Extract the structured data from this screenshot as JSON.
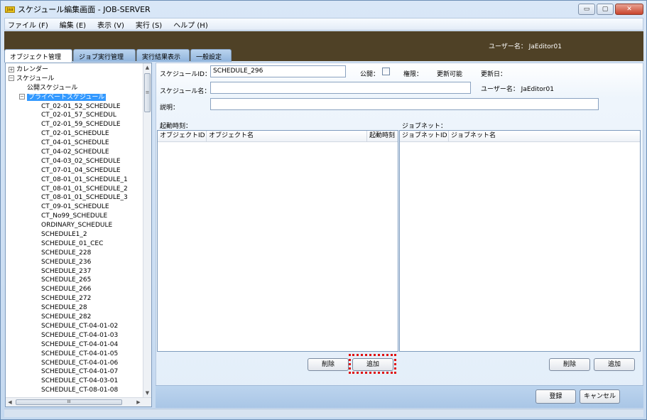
{
  "window": {
    "app_icon_text": "Jaa",
    "title": "スケジュール編集画面 - JOB-SERVER",
    "buttons": {
      "minimize": "▭",
      "maximize": "▢",
      "close": "✕"
    }
  },
  "menu": [
    "ファイル (F)",
    "編集 (E)",
    "表示 (V)",
    "実行 (S)",
    "ヘルプ (H)"
  ],
  "header": {
    "user": "ユーザー名： JaEditor01"
  },
  "tabs": [
    "オブジェクト管理",
    "ジョブ実行管理",
    "実行結果表示",
    "一般設定"
  ],
  "tree": {
    "calendar": "カレンダー",
    "schedule": "スケジュール",
    "public_schedule": "公開スケジュール",
    "private_schedule": "プライベートスケジュール",
    "expand_plus": "+",
    "expand_minus": "−",
    "items": [
      "CT_02-01_52_SCHEDULE",
      "CT_02-01_57_SCHEDUL",
      "CT_02-01_59_SCHEDULE",
      "CT_02-01_SCHEDULE",
      "CT_04-01_SCHEDULE",
      "CT_04-02_SCHEDULE",
      "CT_04-03_02_SCHEDULE",
      "CT_07-01_04_SCHEDULE",
      "CT_08-01_01_SCHEDULE_1",
      "CT_08-01_01_SCHEDULE_2",
      "CT_08-01_01_SCHEDULE_3",
      "CT_09-01_SCHEDULE",
      "CT_No99_SCHEDULE",
      "ORDINARY_SCHEDULE",
      "SCHEDULE1_2",
      "SCHEDULE_01_CEC",
      "SCHEDULE_228",
      "SCHEDULE_236",
      "SCHEDULE_237",
      "SCHEDULE_265",
      "SCHEDULE_266",
      "SCHEDULE_272",
      "SCHEDULE_28",
      "SCHEDULE_282",
      "SCHEDULE_CT-04-01-02",
      "SCHEDULE_CT-04-01-03",
      "SCHEDULE_CT-04-01-04",
      "SCHEDULE_CT-04-01-05",
      "SCHEDULE_CT-04-01-06",
      "SCHEDULE_CT-04-01-07",
      "SCHEDULE_CT-04-03-01",
      "SCHEDULE_CT-08-01-08"
    ],
    "scroll": {
      "up": "▲",
      "down": "▼",
      "left": "◀",
      "right": "▶",
      "grip": "≡",
      "hgrip": "III"
    }
  },
  "form": {
    "schedule_id_label": "スケジュールID：",
    "schedule_id_value": "SCHEDULE_296",
    "public_label": "公開：",
    "permission_label": "権限：",
    "permission_value": "更新可能",
    "updated_date_label": "更新日：",
    "schedule_name_label": "スケジュール名：",
    "schedule_name_value": "",
    "user_label": "ユーザー名： JaEditor01",
    "description_label": "説明：",
    "description_value": ""
  },
  "start_time_section": {
    "title": "起動時刻：",
    "columns": [
      "オブジェクトID",
      "オブジェクト名",
      "起動時刻"
    ],
    "delete_label": "削除",
    "add_label": "追加"
  },
  "jobnet_section": {
    "title": "ジョブネット：",
    "columns": [
      "ジョブネットID",
      "ジョブネット名"
    ],
    "delete_label": "削除",
    "add_label": "追加"
  },
  "footer": {
    "register_label": "登録",
    "cancel_label": "キャンセル"
  }
}
